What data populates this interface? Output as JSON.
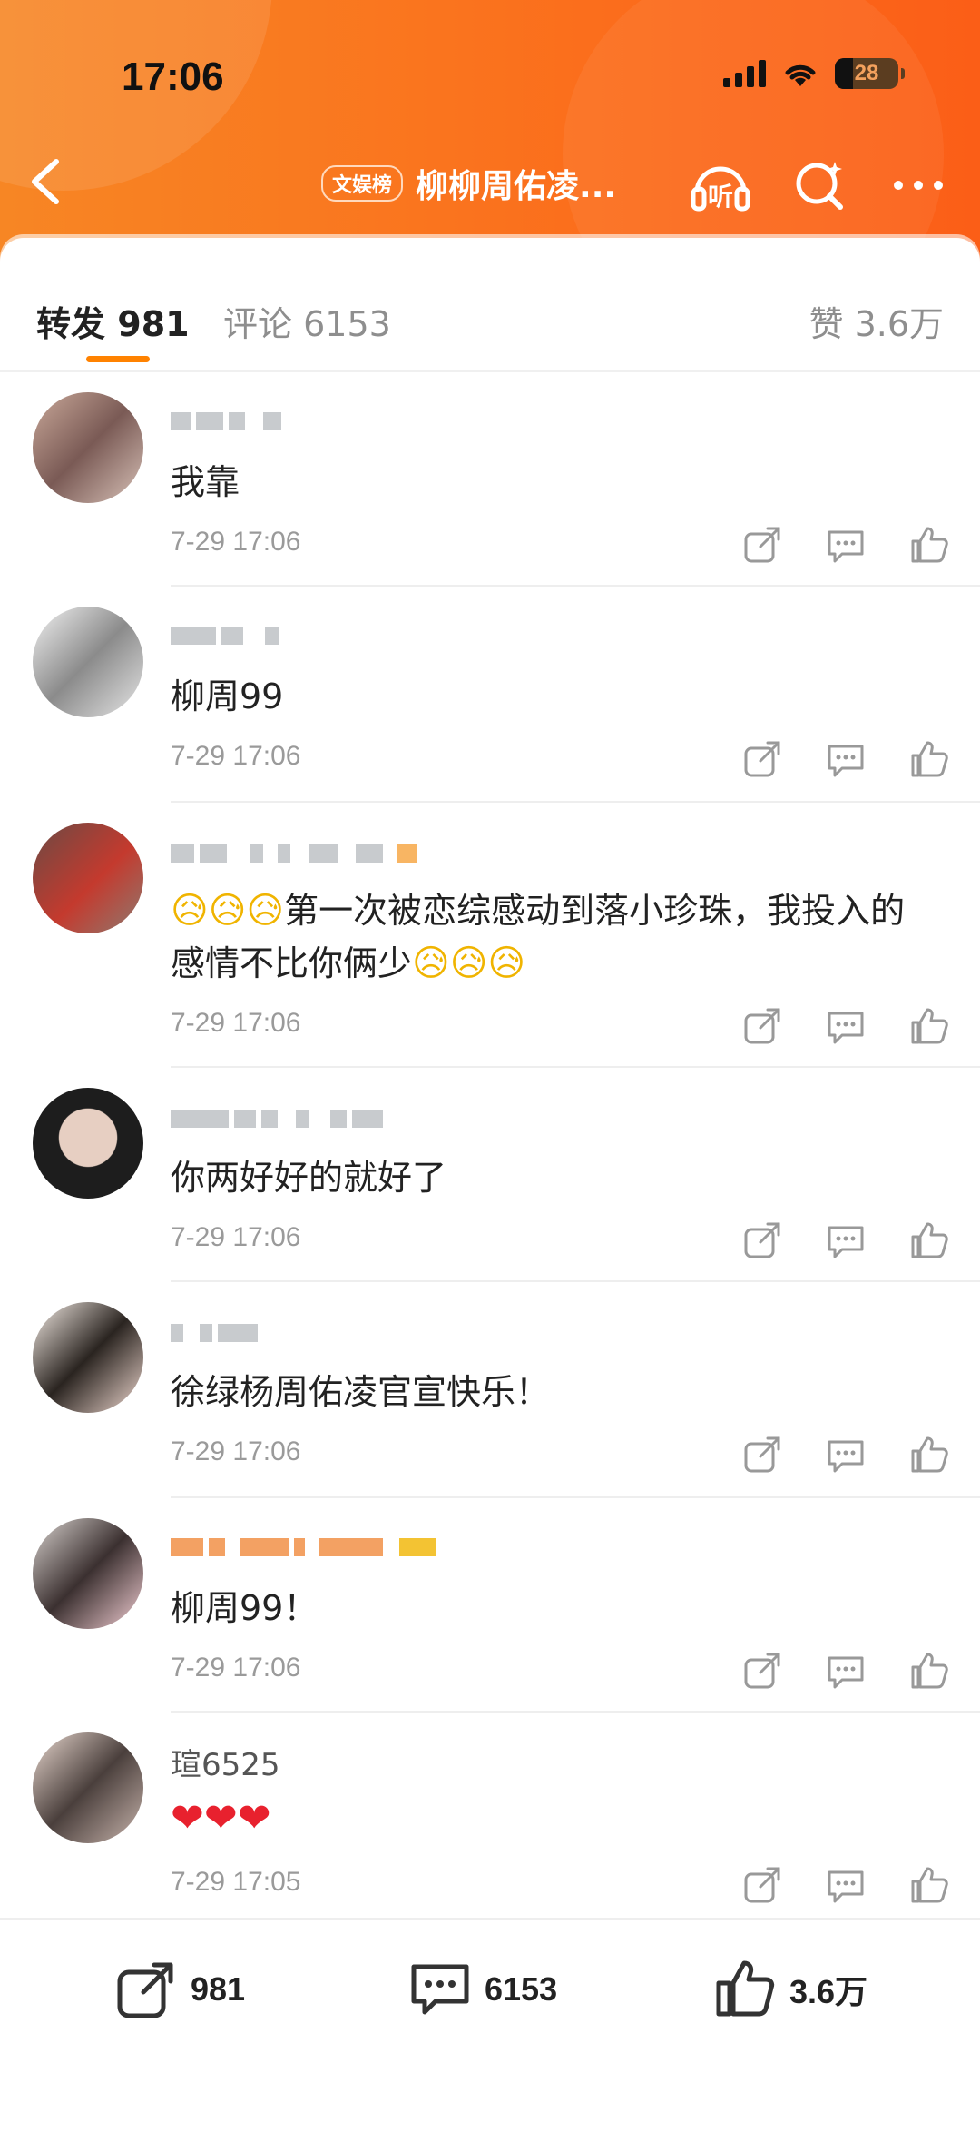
{
  "status_bar": {
    "time": "17:06",
    "battery": "28",
    "battery_level": 0.28
  },
  "nav": {
    "tag": "文娱榜",
    "title": "柳柳周佑凌...",
    "listen_label": "听"
  },
  "tabs": {
    "repost": {
      "label": "转发",
      "count": "981"
    },
    "comment": {
      "label": "评论",
      "count": "6153"
    },
    "likes": {
      "label": "赞",
      "count": "3.6万"
    }
  },
  "comments": [
    {
      "username": "",
      "text": "我靠",
      "time": "7-29 17:06"
    },
    {
      "username": "",
      "text": "柳周99",
      "time": "7-29 17:06"
    },
    {
      "username": "",
      "text": "第一次被恋综感动到落小珍珠，我投入的感情不比你俩少",
      "time": "7-29 17:06"
    },
    {
      "username": "",
      "text": "你两好好的就好了",
      "time": "7-29 17:06"
    },
    {
      "username": "",
      "text": "徐绿杨周佑凌官宣快乐！",
      "time": "7-29 17:06"
    },
    {
      "username": "",
      "text": "柳周99！",
      "time": "7-29 17:06"
    },
    {
      "username": "瑄6525",
      "text": "",
      "time": "7-29 17:05"
    }
  ],
  "bottom_bar": {
    "repost_count": "981",
    "comment_count": "6153",
    "like_count": "3.6万"
  },
  "colors": {
    "header_orange": "#fb6e1c",
    "accent": "#ff8200",
    "heart": "#e8212e"
  },
  "icons": [
    "back-icon",
    "listen-icon",
    "search-icon",
    "more-icon",
    "repost-icon",
    "comment-icon",
    "like-icon"
  ]
}
